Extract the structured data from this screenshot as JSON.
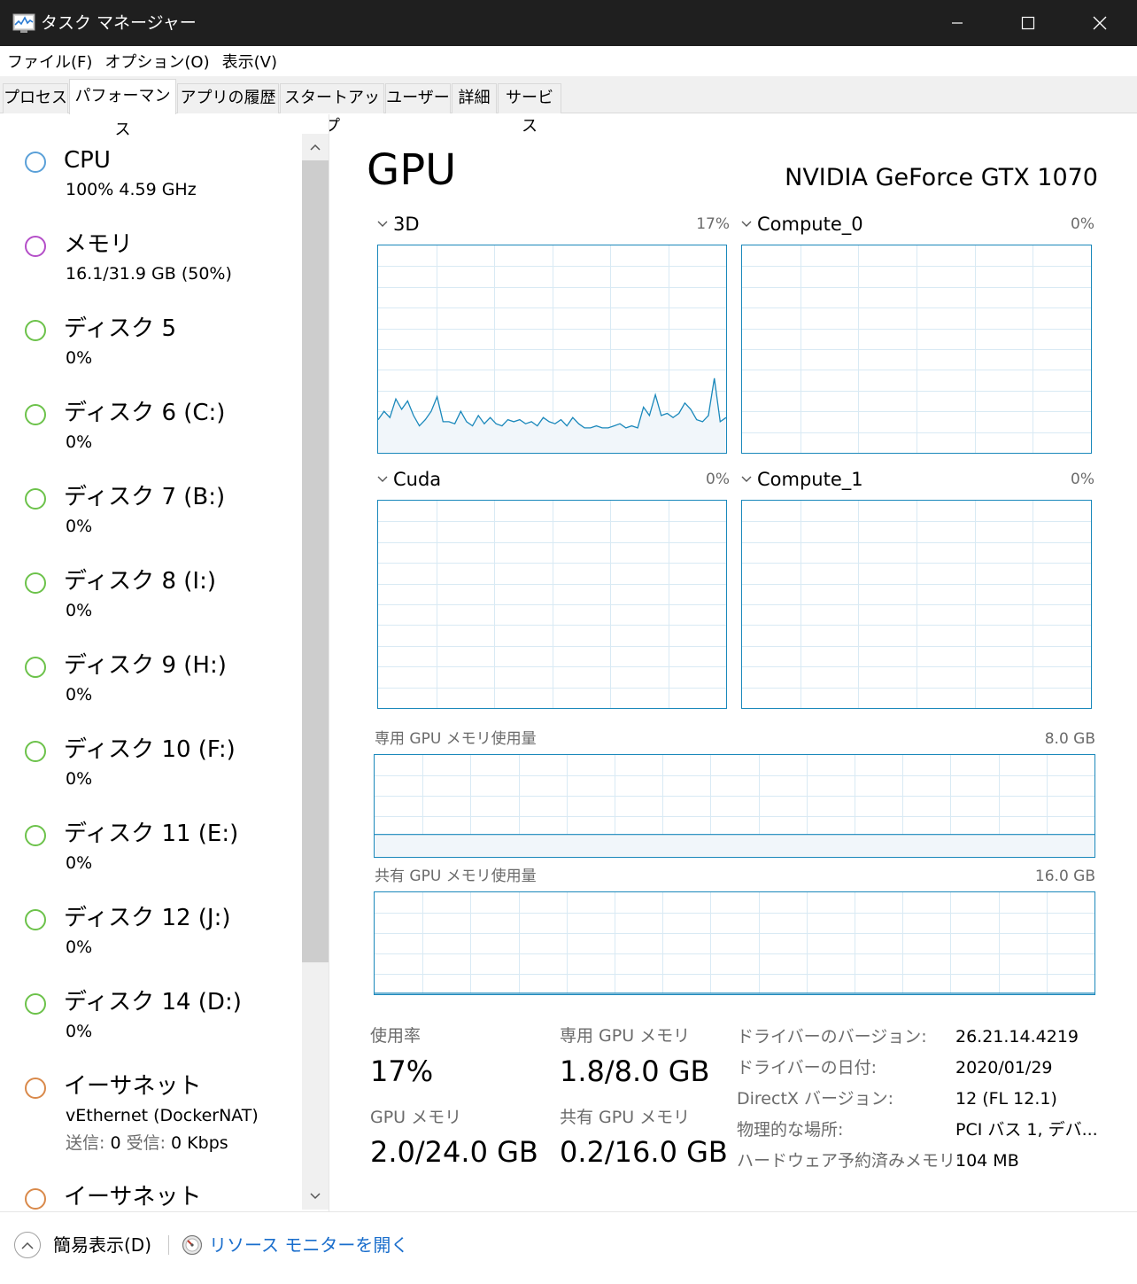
{
  "window": {
    "title": "タスク マネージャー",
    "icon": "task-manager-icon"
  },
  "menu": {
    "file": "ファイル(F)",
    "options": "オプション(O)",
    "view": "表示(V)"
  },
  "tabs": [
    {
      "label": "プロセス"
    },
    {
      "label": "パフォーマンス",
      "active": true
    },
    {
      "label": "アプリの履歴"
    },
    {
      "label": "スタートアップ"
    },
    {
      "label": "ユーザー"
    },
    {
      "label": "詳細"
    },
    {
      "label": "サービス"
    }
  ],
  "sidebar": {
    "items": [
      {
        "name": "CPU",
        "sub": "100%  4.59 GHz",
        "color": "#5aa0d8"
      },
      {
        "name": "メモリ",
        "sub": "16.1/31.9 GB (50%)",
        "color": "#b44ec8"
      },
      {
        "name": "ディスク 5",
        "sub": "0%",
        "color": "#6cc24a"
      },
      {
        "name": "ディスク 6 (C:)",
        "sub": "0%",
        "color": "#6cc24a"
      },
      {
        "name": "ディスク 7 (B:)",
        "sub": "0%",
        "color": "#6cc24a"
      },
      {
        "name": "ディスク 8 (I:)",
        "sub": "0%",
        "color": "#6cc24a"
      },
      {
        "name": "ディスク 9 (H:)",
        "sub": "0%",
        "color": "#6cc24a"
      },
      {
        "name": "ディスク 10 (F:)",
        "sub": "0%",
        "color": "#6cc24a"
      },
      {
        "name": "ディスク 11 (E:)",
        "sub": "0%",
        "color": "#6cc24a"
      },
      {
        "name": "ディスク 12 (J:)",
        "sub": "0%",
        "color": "#6cc24a"
      },
      {
        "name": "ディスク 14 (D:)",
        "sub": "0%",
        "color": "#6cc24a"
      },
      {
        "name": "イーサネット",
        "sub": "vEthernet (DockerNAT)",
        "sub2_send_label": "送信:",
        "sub2_send": "0",
        "sub2_recv_label": "受信:",
        "sub2_recv": "0 Kbps",
        "color": "#d9894a"
      },
      {
        "name": "イーサネット",
        "sub": "",
        "color": "#d9894a"
      }
    ]
  },
  "gpu": {
    "title": "GPU",
    "model": "NVIDIA GeForce GTX 1070",
    "engines": [
      {
        "label": "3D",
        "percent": "17%"
      },
      {
        "label": "Compute_0",
        "percent": "0%"
      },
      {
        "label": "Cuda",
        "percent": "0%"
      },
      {
        "label": "Compute_1",
        "percent": "0%"
      }
    ],
    "dedicated_mem_label": "専用 GPU メモリ使用量",
    "dedicated_mem_max": "8.0 GB",
    "shared_mem_label": "共有 GPU メモリ使用量",
    "shared_mem_max": "16.0 GB",
    "accent": "#1a88bb"
  },
  "chart_data": {
    "type": "area",
    "title": "3D",
    "ylim": [
      0,
      100
    ],
    "x": [
      0,
      1,
      2,
      3,
      4,
      5,
      6,
      7,
      8,
      9,
      10,
      11,
      12,
      13,
      14,
      15,
      16,
      17,
      18,
      19,
      20,
      21,
      22,
      23,
      24,
      25,
      26,
      27,
      28,
      29,
      30,
      31,
      32,
      33,
      34,
      35,
      36,
      37,
      38,
      39,
      40,
      41,
      42,
      43,
      44,
      45,
      46,
      47,
      48,
      49,
      50,
      51,
      52,
      53,
      54,
      55,
      56,
      57,
      58,
      59
    ],
    "series": [
      {
        "values": [
          16,
          20,
          17,
          26,
          21,
          25,
          18,
          13,
          16,
          20,
          27,
          15,
          15,
          14,
          20,
          15,
          13,
          18,
          14,
          17,
          14,
          13,
          16,
          15,
          16,
          14,
          15,
          13,
          17,
          15,
          14,
          16,
          13,
          17,
          14,
          12,
          12,
          13,
          12,
          12,
          13,
          14,
          12,
          13,
          12,
          22,
          18,
          28,
          18,
          19,
          17,
          19,
          24,
          21,
          16,
          15,
          18,
          36,
          15,
          17
        ]
      }
    ]
  },
  "stats": {
    "utilization_label": "使用率",
    "utilization": "17%",
    "dedicated_label": "専用 GPU メモリ",
    "dedicated": "1.8/8.0 GB",
    "gpu_mem_label": "GPU メモリ",
    "gpu_mem": "2.0/24.0 GB",
    "shared_label": "共有 GPU メモリ",
    "shared": "0.2/16.0 GB"
  },
  "info": [
    {
      "label": "ドライバーのバージョン:",
      "value": "26.21.14.4219"
    },
    {
      "label": "ドライバーの日付:",
      "value": "2020/01/29"
    },
    {
      "label": "DirectX バージョン:",
      "value": "12 (FL 12.1)"
    },
    {
      "label": "物理的な場所:",
      "value": "PCI バス 1, デバ..."
    },
    {
      "label": "ハードウェア予約済みメモリ:",
      "value": "104 MB"
    }
  ],
  "footer": {
    "fewer_details": "簡易表示(D)",
    "resource_monitor": "リソース モニターを開く"
  },
  "memory_usage": {
    "dedicated_percent": 22,
    "shared_percent": 1
  }
}
